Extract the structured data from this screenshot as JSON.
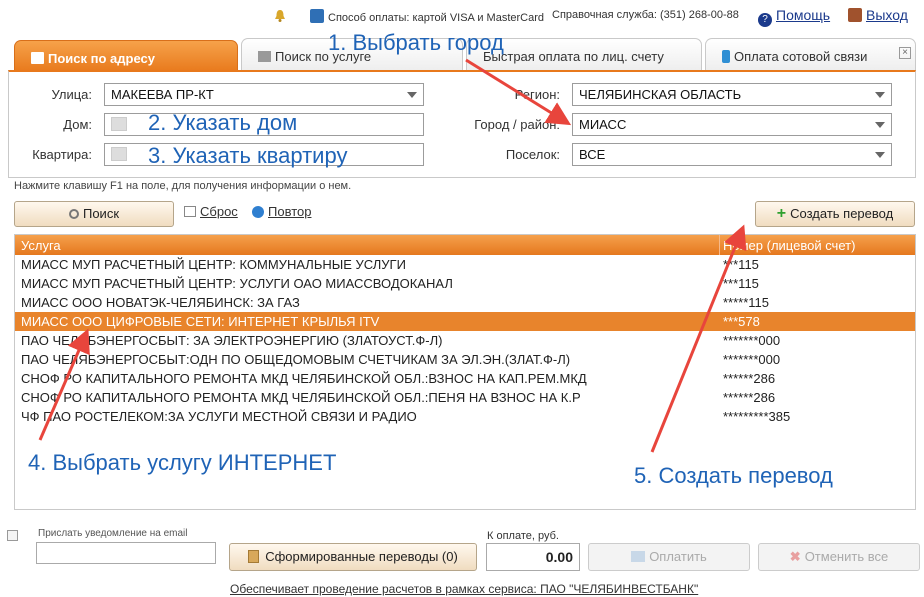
{
  "topbar": {
    "payment": "Способ оплаты: картой VISA и MasterCard",
    "support": "Справочная служба: (351) 268-00-88",
    "help": "Помощь",
    "exit": "Выход"
  },
  "tabs": [
    {
      "label": "Поиск по адресу"
    },
    {
      "label": "Поиск по услуге"
    },
    {
      "label": "Быстрая оплата по лиц. счету"
    },
    {
      "label": "Оплата сотовой связи"
    }
  ],
  "form": {
    "street_label": "Улица:",
    "street_value": "МАКЕЕВА ПР-КТ",
    "house_label": "Дом:",
    "apartment_label": "Квартира:",
    "region_label": "Регион:",
    "region_value": "ЧЕЛЯБИНСКАЯ ОБЛАСТЬ",
    "city_label": "Город / район:",
    "city_value": "МИАСС",
    "settlement_label": "Поселок:",
    "settlement_value": "ВСЕ"
  },
  "hint": "Нажмите клавишу F1 на поле, для получения информации о нем.",
  "toolbar": {
    "search": "Поиск",
    "reset": "Сброс",
    "repeat": "Повтор",
    "create": "Создать перевод"
  },
  "table": {
    "col_service": "Услуга",
    "col_account": "Номер (лицевой счет)",
    "rows": [
      {
        "service": "МИАСС МУП РАСЧЕТНЫЙ ЦЕНТР: КОММУНАЛЬНЫЕ УСЛУГИ",
        "account": "***115"
      },
      {
        "service": "МИАСС МУП РАСЧЕТНЫЙ ЦЕНТР: УСЛУГИ ОАО МИАССВОДОКАНАЛ",
        "account": "***115"
      },
      {
        "service": "МИАСС ООО НОВАТЭК-ЧЕЛЯБИНСК: ЗА ГАЗ",
        "account": "*****115"
      },
      {
        "service": "МИАСС ООО ЦИФРОВЫЕ СЕТИ: ИНТЕРНЕТ КРЫЛЬЯ ITV",
        "account": "***578"
      },
      {
        "service": "ПАО ЧЕЛЯБЭНЕРГОСБЫТ: ЗА ЭЛЕКТРОЭНЕРГИЮ (ЗЛАТОУСТ.Ф-Л)",
        "account": "*******000"
      },
      {
        "service": "ПАО ЧЕЛЯБЭНЕРГОСБЫТ:ОДН ПО ОБЩЕДОМОВЫМ СЧЕТЧИКАМ ЗА ЭЛ.ЭН.(ЗЛАТ.Ф-Л)",
        "account": "*******000"
      },
      {
        "service": "СНОФ РО КАПИТАЛЬНОГО РЕМОНТА МКД ЧЕЛЯБИНСКОЙ ОБЛ.:ВЗНОС НА КАП.РЕМ.МКД",
        "account": "******286"
      },
      {
        "service": "СНОФ РО КАПИТАЛЬНОГО РЕМОНТА МКД ЧЕЛЯБИНСКОЙ ОБЛ.:ПЕНЯ НА ВЗНОС НА К.Р",
        "account": "******286"
      },
      {
        "service": "ЧФ ПАО РОСТЕЛЕКОМ:ЗА УСЛУГИ МЕСТНОЙ СВЯЗИ И РАДИО",
        "account": "*********385"
      }
    ]
  },
  "bottom": {
    "notify_placeholder": "Прислать уведомление на email",
    "generated": "Сформированные переводы (0)",
    "to_pay_label": "К оплате, руб.",
    "amount": "0.00",
    "pay": "Оплатить",
    "cancel_all": "Отменить все",
    "footer": "Обеспечивает проведение расчетов в рамках сервиса: ПАО \"ЧЕЛЯБИНВЕСТБАНК\""
  },
  "annotations": {
    "a1": "1. Выбрать город",
    "a2": "2. Указать дом",
    "a3": "3. Указать квартиру",
    "a4": "4. Выбрать услугу ИНТЕРНЕТ",
    "a5": "5. Создать перевод"
  },
  "colors": {
    "accent": "#e8791c",
    "annotation": "#1f63b6",
    "arrow": "#e8453c"
  }
}
